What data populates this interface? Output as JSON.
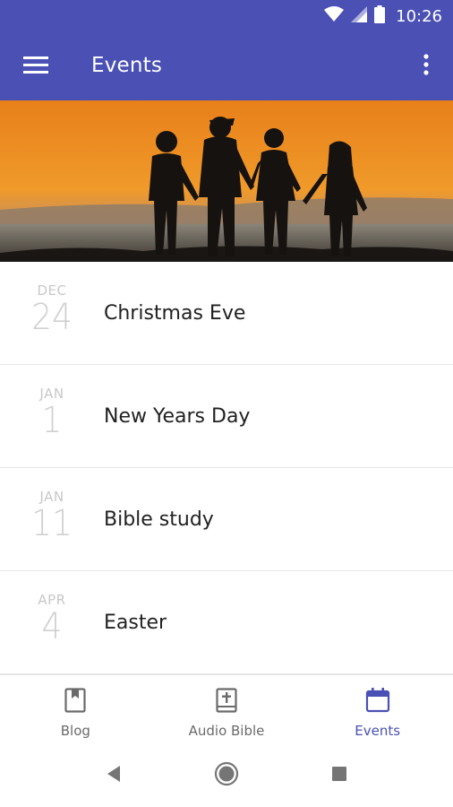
{
  "status_bar": {
    "time": "10:26"
  },
  "app_bar": {
    "title": "Events",
    "menu_icon": "hamburger-menu-icon",
    "overflow_icon": "more-vert-icon"
  },
  "hero": {
    "description": "silhouette-family-sunset-image"
  },
  "events": [
    {
      "month": "DEC",
      "day": "24",
      "title": "Christmas Eve"
    },
    {
      "month": "JAN",
      "day": "1",
      "title": "New Years Day"
    },
    {
      "month": "JAN",
      "day": "11",
      "title": "Bible study"
    },
    {
      "month": "APR",
      "day": "4",
      "title": "Easter"
    }
  ],
  "bottom_nav": {
    "items": [
      {
        "label": "Blog",
        "icon": "bookmark-book-icon",
        "active": false
      },
      {
        "label": "Audio Bible",
        "icon": "bible-icon",
        "active": false
      },
      {
        "label": "Events",
        "icon": "calendar-icon",
        "active": true
      }
    ]
  },
  "colors": {
    "primary": "#4a50b4",
    "text": "#212121",
    "muted": "#c8c8c8"
  }
}
